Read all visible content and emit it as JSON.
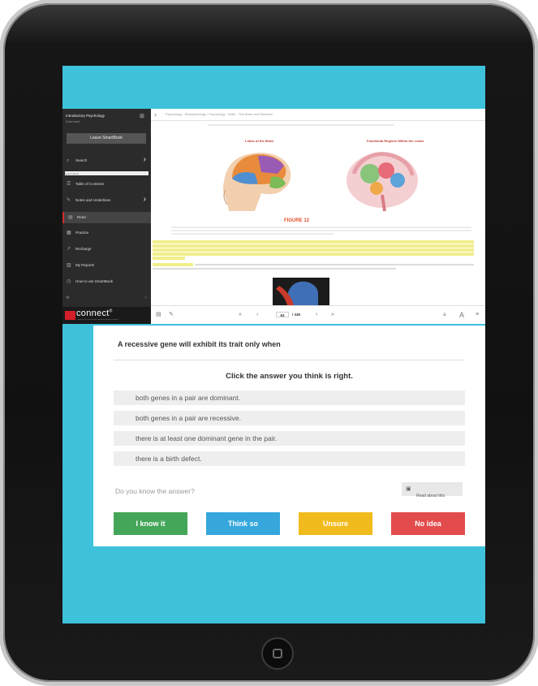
{
  "sidebar": {
    "course_title": "Introductory Psychology",
    "subtitle": "Core Level",
    "leave_label": "Leave SmartBook",
    "search_label": "Search",
    "search_placeholder": "Search Book",
    "items": [
      {
        "label": "Table of Contents",
        "icon": "list-icon"
      },
      {
        "label": "Notes and Underlines",
        "icon": "note-icon"
      },
      {
        "label": "Read",
        "icon": "read-icon"
      },
      {
        "label": "Practice",
        "icon": "practice-icon"
      },
      {
        "label": "Recharge",
        "icon": "recharge-icon"
      },
      {
        "label": "My Reports",
        "icon": "reports-icon"
      },
      {
        "label": "How to use SmartBook",
        "icon": "help-icon"
      }
    ],
    "brand": "connect",
    "brand_mark": "®",
    "copyright": "Copyright 2014 McGraw-Hill Education. All rights reserved."
  },
  "document": {
    "breadcrumb": "Psychology · Biopsychology / Psychology · Brain · The Brain and Behavior",
    "left_figure_title": "Lobes of the Brain",
    "right_figure_title": "Functional Regions Within the Lobes",
    "figure_label": "FIGURE 12"
  },
  "toolbar": {
    "current_page": "63",
    "total_pages": "/ 336"
  },
  "question": {
    "prompt": "A recessive gene will exhibit its trait only when",
    "instruction": "Click the answer you think is right.",
    "options": [
      "both genes in a pair are dominant.",
      "both genes in a pair are recessive.",
      "there is at least one dominant gene in the pair.",
      "there is a birth defect."
    ],
    "confidence_prompt": "Do you know the answer?",
    "read_about_label": "Read about this",
    "buttons": {
      "know": "I know it",
      "think": "Think so",
      "unsure": "Unsure",
      "no_idea": "No idea"
    }
  },
  "colors": {
    "screen_bg": "#3ec2dc",
    "know": "#44a659",
    "think": "#35a7dd",
    "unsure": "#f2bb1d",
    "no_idea": "#e24c4c",
    "brand_red": "#d41f2a"
  }
}
